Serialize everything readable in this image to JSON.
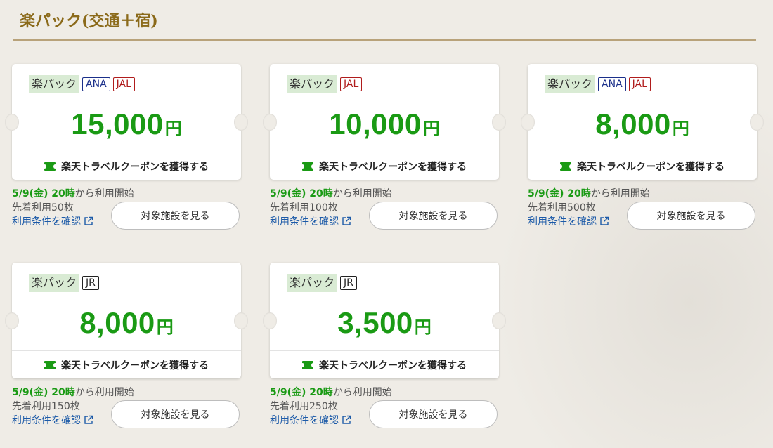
{
  "section": {
    "title": "楽パック(交通＋宿)"
  },
  "common": {
    "pack_label": "楽パック",
    "yen": "円",
    "coupon_label": "楽天トラベルクーポンを獲得する",
    "start_date": "5/9(金) 20時",
    "start_suffix": "から利用開始",
    "terms_label": "利用条件を確認",
    "hotel_button": "対象施設を見る"
  },
  "cards": [
    {
      "carriers": [
        "ANA",
        "JAL"
      ],
      "amount": "15,000",
      "limit": "先着利用50枚"
    },
    {
      "carriers": [
        "JAL"
      ],
      "amount": "10,000",
      "limit": "先着利用100枚"
    },
    {
      "carriers": [
        "ANA",
        "JAL"
      ],
      "amount": "8,000",
      "limit": "先着利用500枚"
    },
    {
      "carriers": [
        "JR"
      ],
      "amount": "8,000",
      "limit": "先着利用150枚"
    },
    {
      "carriers": [
        "JR"
      ],
      "amount": "3,500",
      "limit": "先着利用250枚"
    }
  ],
  "colors": {
    "accent": "#1a9a14",
    "title": "#8b6a1a",
    "link": "#1c5aa8",
    "ana": "#1a2f8a",
    "jal": "#b01c1c"
  },
  "icons": {
    "coupon": "ticket-icon",
    "external": "external-link-icon"
  }
}
